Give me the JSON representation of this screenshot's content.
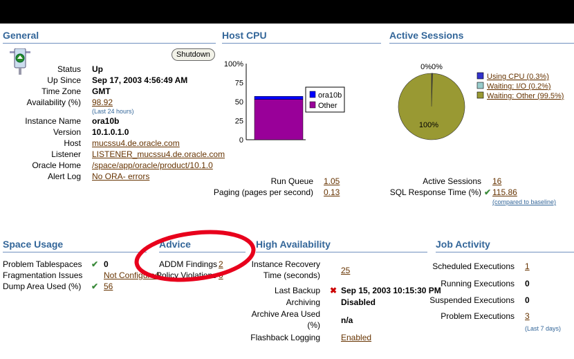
{
  "general": {
    "title": "General",
    "shutdown_label": "Shutdown",
    "status_label": "Status",
    "status_value": "Up",
    "upsince_label": "Up Since",
    "upsince_value": "Sep 17, 2003 4:56:49 AM",
    "timezone_label": "Time Zone",
    "timezone_value": "GMT",
    "availability_label": "Availability (%)",
    "availability_value": "98.92",
    "availability_note": "(Last 24 hours)",
    "instance_label": "Instance Name",
    "instance_value": "ora10b",
    "version_label": "Version",
    "version_value": "10.1.0.1.0",
    "host_label": "Host",
    "host_value": "mucssu4.de.oracle.com",
    "listener_label": "Listener",
    "listener_value": "LISTENER_mucssu4.de.oracle.com",
    "home_label": "Oracle Home",
    "home_value": "/space/app/oracle/product/10.1.0",
    "alertlog_label": "Alert Log",
    "alertlog_value": "No ORA- errors"
  },
  "host_cpu": {
    "title": "Host CPU",
    "y_ticks": [
      "100%",
      "75",
      "50",
      "25",
      "0"
    ],
    "legend": [
      {
        "name": "ora10b",
        "color": "#0000ff"
      },
      {
        "name": "Other",
        "color": "#990099"
      }
    ],
    "runqueue_label": "Run Queue",
    "runqueue_value": "1.05",
    "paging_label": "Paging (pages per second)",
    "paging_value": "0.13"
  },
  "active_sessions": {
    "title": "Active Sessions",
    "pie_labels_top": "0%0%",
    "pie_label_main": "100%",
    "legend": [
      {
        "name": "Using CPU (0.3%)",
        "color": "#3333cc"
      },
      {
        "name": "Waiting: I/O (0.2%)",
        "color": "#99cccc"
      },
      {
        "name": "Waiting: Other (99.5%)",
        "color": "#999933"
      }
    ],
    "sessions_label": "Active Sessions",
    "sessions_value": "16",
    "sql_label": "SQL Response Time (%)",
    "sql_value": "115.86",
    "sql_note": "(compared to baseline)"
  },
  "space_usage": {
    "title": "Space Usage",
    "problem_label": "Problem Tablespaces",
    "problem_value": "0",
    "frag_label": "Fragmentation Issues",
    "frag_value": "Not Configured",
    "dump_label": "Dump Area Used (%)",
    "dump_value": "56"
  },
  "advice": {
    "title": "Advice",
    "addm_label": "ADDM Findings",
    "addm_value": "2",
    "policy_label": "Policy Violations",
    "policy_value": "0"
  },
  "high_availability": {
    "title": "High Availability",
    "recovery_label_1": "Instance Recovery",
    "recovery_label_2": "Time (seconds)",
    "recovery_value": "25",
    "backup_label": "Last Backup",
    "backup_value": "Sep 15, 2003 10:15:30 PM",
    "archiving_label": "Archiving",
    "archiving_value": "Disabled",
    "archive_area_label_1": "Archive Area Used",
    "archive_area_label_2": "(%)",
    "archive_area_value": "n/a",
    "flashback_label": "Flashback Logging",
    "flashback_value": "Enabled"
  },
  "job_activity": {
    "title": "Job Activity",
    "scheduled_label": "Scheduled Executions",
    "scheduled_value": "1",
    "running_label": "Running Executions",
    "running_value": "0",
    "suspended_label": "Suspended Executions",
    "suspended_value": "0",
    "problem_label": "Problem Executions",
    "problem_value": "3",
    "note": "(Last 7 days)"
  },
  "chart_data": [
    {
      "type": "bar",
      "categories": [
        ""
      ],
      "series": [
        {
          "name": "Other",
          "values": [
            53
          ]
        },
        {
          "name": "ora10b",
          "values": [
            4
          ]
        }
      ],
      "title": "Host CPU",
      "ylim": [
        0,
        100
      ],
      "stacked": true,
      "legend": "right"
    },
    {
      "type": "pie",
      "categories": [
        "Using CPU (0.3%)",
        "Waiting: I/O (0.2%)",
        "Waiting: Other (99.5%)"
      ],
      "values": [
        0.3,
        0.2,
        99.5
      ],
      "title": "Active Sessions",
      "legend": "right"
    }
  ]
}
